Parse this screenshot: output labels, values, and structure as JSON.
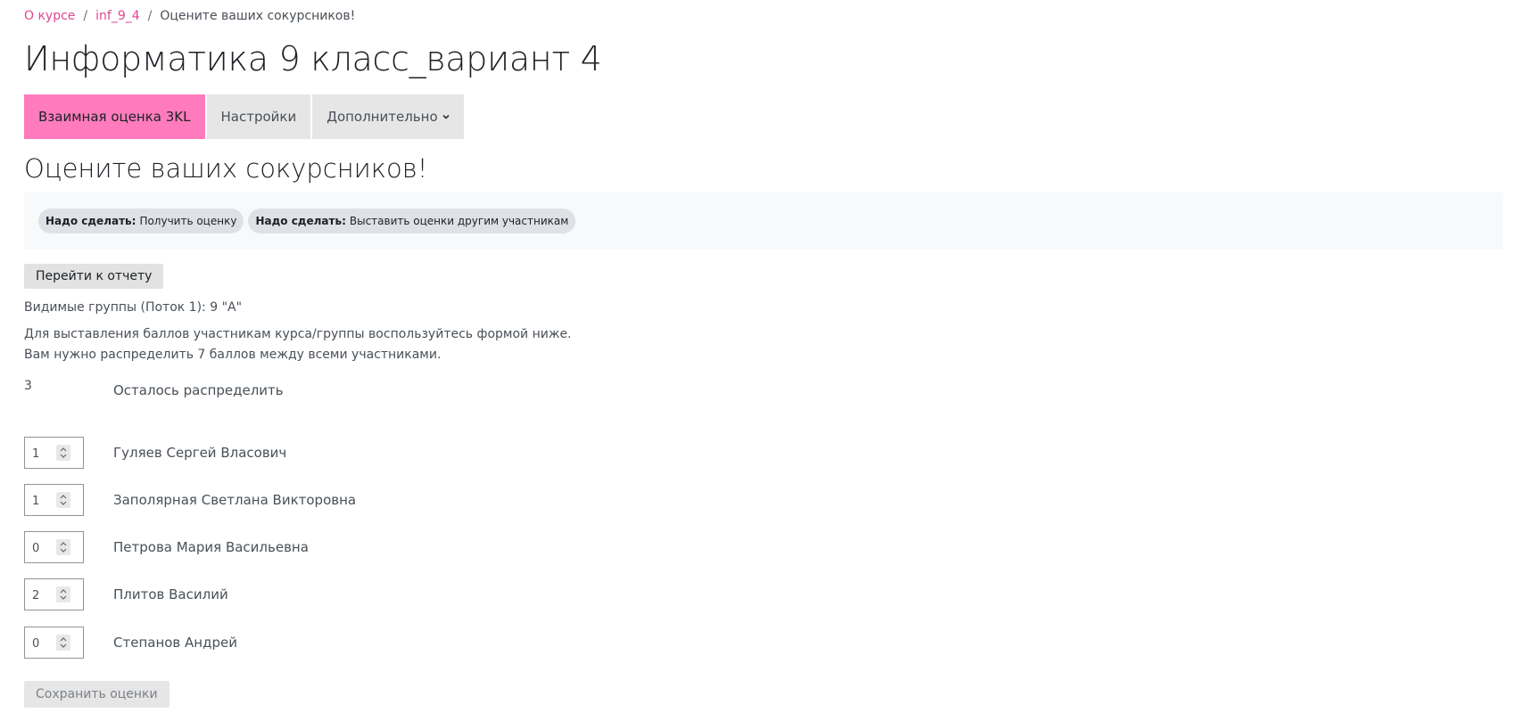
{
  "breadcrumb": {
    "items": [
      "О курсе",
      "inf_9_4"
    ],
    "current": "Оцените ваших сокурсников!",
    "separator": "/"
  },
  "course_title": "Информатика 9 класс_вариант 4",
  "tabs": [
    {
      "label": "Взаимная оценка 3KL",
      "active": true
    },
    {
      "label": "Настройки",
      "active": false
    },
    {
      "label": "Дополнительно",
      "active": false,
      "icon": "chevron-down-icon"
    }
  ],
  "activity_title": "Оцените ваших сокурсников!",
  "completion": {
    "prefix": "Надо сделать:",
    "items": [
      "Получить оценку",
      "Выставить оценки другим участникам"
    ]
  },
  "report_button": "Перейти к отчету",
  "groups_text": "Видимые группы (Поток 1): 9 \"А\"",
  "instructions": [
    "Для выставления баллов участникам курса/группы воспользуйтесь формой ниже.",
    "Вам нужно распределить 7 баллов между всеми участниками."
  ],
  "remaining": {
    "value": "3",
    "label": "Осталось распределить"
  },
  "participants": [
    {
      "name": "Гуляев Сергей Власович",
      "score": "1"
    },
    {
      "name": "Заполярная Светлана Викторовна",
      "score": "1"
    },
    {
      "name": "Петрова Мария Васильевна",
      "score": "0"
    },
    {
      "name": "Плитов Василий",
      "score": "2"
    },
    {
      "name": "Степанов Андрей",
      "score": "0"
    }
  ],
  "save_button": "Сохранить оценки",
  "colors": {
    "link": "#e0478f",
    "active_tab": "#ff7bbd",
    "tab": "#e6e6e6",
    "panel": "#f8f9fa",
    "badge": "#dee2e6"
  }
}
